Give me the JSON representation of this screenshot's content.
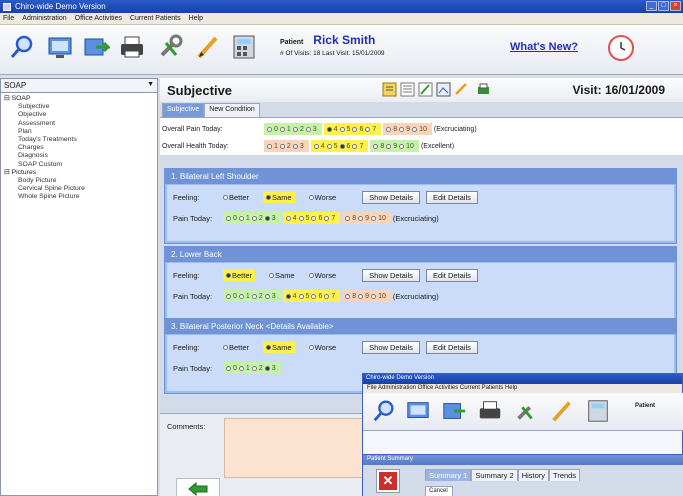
{
  "window": {
    "title": "Chiro-wide Demo Version"
  },
  "menu": [
    "File",
    "Administration",
    "Office Activities",
    "Current Patients",
    "Help"
  ],
  "toolbar": {
    "icons": [
      "search-icon",
      "monitor-icon",
      "export-icon",
      "printer-icon",
      "tools-icon",
      "pen-icon",
      "calculator-icon"
    ],
    "patient_label": "Patient",
    "patient_name": "Rick Smith",
    "visit_info": "# Of Visits: 18    Last Visit: 15/01/2009",
    "whats_new": "What's New?"
  },
  "left": {
    "dropdown": "SOAP",
    "tree": [
      {
        "group": "SOAP",
        "items": [
          "Subjective",
          "Objective",
          "Assessment",
          "Plan",
          "Today's Treatments",
          "Charges",
          "Diagnosis",
          "SOAP Custom"
        ]
      },
      {
        "group": "Pictures",
        "items": [
          "Body Picture",
          "Cervical Spine Picture",
          "Whole Spine Picture"
        ]
      }
    ]
  },
  "main": {
    "title": "Subjective",
    "visit": "Visit: 16/01/2009",
    "tabs": [
      "Subjective",
      "New Condition"
    ],
    "overall_pain_label": "Overall Pain Today:",
    "overall_health_label": "Overall Health Today:",
    "pain_scale_low": [
      "0",
      "1",
      "2",
      "3"
    ],
    "pain_scale_mid": [
      "4",
      "5",
      "6",
      "7"
    ],
    "pain_scale_high": [
      "8",
      "9",
      "10"
    ],
    "health_scale_low": [
      "1",
      "2",
      "3"
    ],
    "health_scale_mid": [
      "4",
      "5",
      "6",
      "7"
    ],
    "health_scale_high": [
      "8",
      "9",
      "10"
    ],
    "excruciating": "(Excruciating)",
    "excellent": "(Excellent)",
    "overall_pain_selected": "4",
    "overall_health_selected": "6"
  },
  "complaints": [
    {
      "title": "1. Bilateral Left Shoulder",
      "feeling": "Same",
      "pain": "3"
    },
    {
      "title": "2. Lower Back",
      "feeling": "Better",
      "pain": "4"
    },
    {
      "title": "3. Bilateral Posterior Neck   <Details Available>",
      "feeling": "Same",
      "pain": "3"
    }
  ],
  "labels": {
    "feeling": "Feeling:",
    "pain_today": "Pain Today:",
    "better": "Better",
    "same": "Same",
    "worse": "Worse",
    "show_details": "Show Details",
    "edit_details": "Edit Details",
    "comments": "Comments:"
  },
  "overlay": {
    "title": "Chiro-wide Demo Version",
    "menu": "File   Administration   Office Activities   Current Patients   Help",
    "patient": "Patient",
    "inner_title": "Patient Summary",
    "tabs": [
      "Summary 1",
      "Summary 2",
      "History",
      "Trends"
    ],
    "button": "Cancel"
  }
}
